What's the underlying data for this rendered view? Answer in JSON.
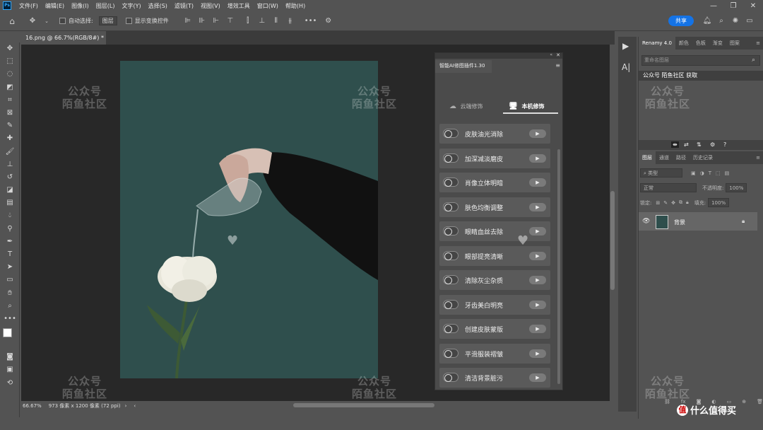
{
  "app": {
    "logo": "Ps",
    "menu": [
      "文件(F)",
      "编辑(E)",
      "图像(I)",
      "图层(L)",
      "文字(Y)",
      "选择(S)",
      "滤镜(T)",
      "视图(V)",
      "增效工具",
      "窗口(W)",
      "帮助(H)"
    ],
    "window_controls": [
      "—",
      "❐",
      "✕"
    ]
  },
  "options": {
    "auto_select_label": "自动选择:",
    "auto_select_value": "图层",
    "show_transform_label": "显示变换控件",
    "more": "•••",
    "share_label": "共享"
  },
  "document": {
    "tab_label": "16.png @ 66.7%(RGB/8#) *",
    "tab_close": "×",
    "zoom": "66.67%",
    "dimensions": "973 像素 x 1200 像素 (72 ppi)"
  },
  "plugin": {
    "title": "智能AI修图插件1.30",
    "tab_cloud": "云端修饰",
    "tab_local": "本机修饰",
    "play_symbol": "▶",
    "features": [
      "皮肤油光消除",
      "加深减淡磨皮",
      "肖像立体明暗",
      "肤色均衡调整",
      "眼睛血丝去除",
      "眼部提亮清晰",
      "清除灰尘杂质",
      "牙齿美白明亮",
      "创建皮肤蒙版",
      "平滑服装褶皱",
      "清洁背景脏污"
    ]
  },
  "right_panel": {
    "top_tabs": [
      "Renamy 4.0",
      "颜色",
      "色板",
      "渐变",
      "图案"
    ],
    "renamy_placeholder": "重命名图层",
    "renamy_item": "公众号 陌鱼社区 获取",
    "layer_tabs": [
      "图层",
      "通道",
      "路径",
      "历史记录"
    ],
    "kind_label": "类型",
    "blend_mode": "正常",
    "opacity_label": "不透明度:",
    "opacity_value": "100%",
    "lock_label": "锁定:",
    "fill_label": "填充:",
    "fill_value": "100%",
    "layer_name": "背景"
  },
  "watermark": {
    "line1": "公众号",
    "line2": "陌鱼社区"
  },
  "footer_logo": {
    "mark": "值",
    "text": "什么值得买"
  }
}
